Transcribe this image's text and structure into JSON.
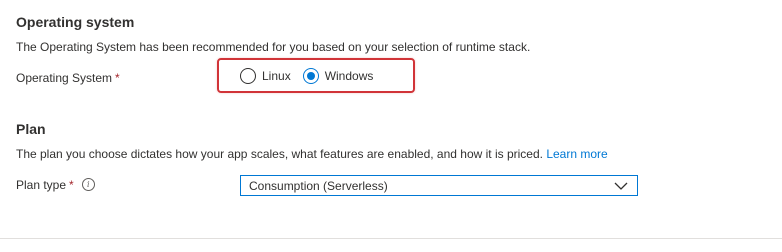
{
  "os_section": {
    "title": "Operating system",
    "description": "The Operating System has been recommended for you based on your selection of runtime stack.",
    "field_label": "Operating System",
    "required_mark": "*",
    "options": [
      {
        "label": "Linux",
        "selected": false
      },
      {
        "label": "Windows",
        "selected": true
      }
    ]
  },
  "plan_section": {
    "title": "Plan",
    "description": "The plan you choose dictates how your app scales, what features are enabled, and how it is priced.",
    "learn_more": "Learn more",
    "field_label": "Plan type",
    "required_mark": "*",
    "info_icon": "info-icon",
    "selected_value": "Consumption (Serverless)"
  },
  "colors": {
    "accent": "#0078d4",
    "highlight": "#d13438",
    "text": "#323130"
  }
}
